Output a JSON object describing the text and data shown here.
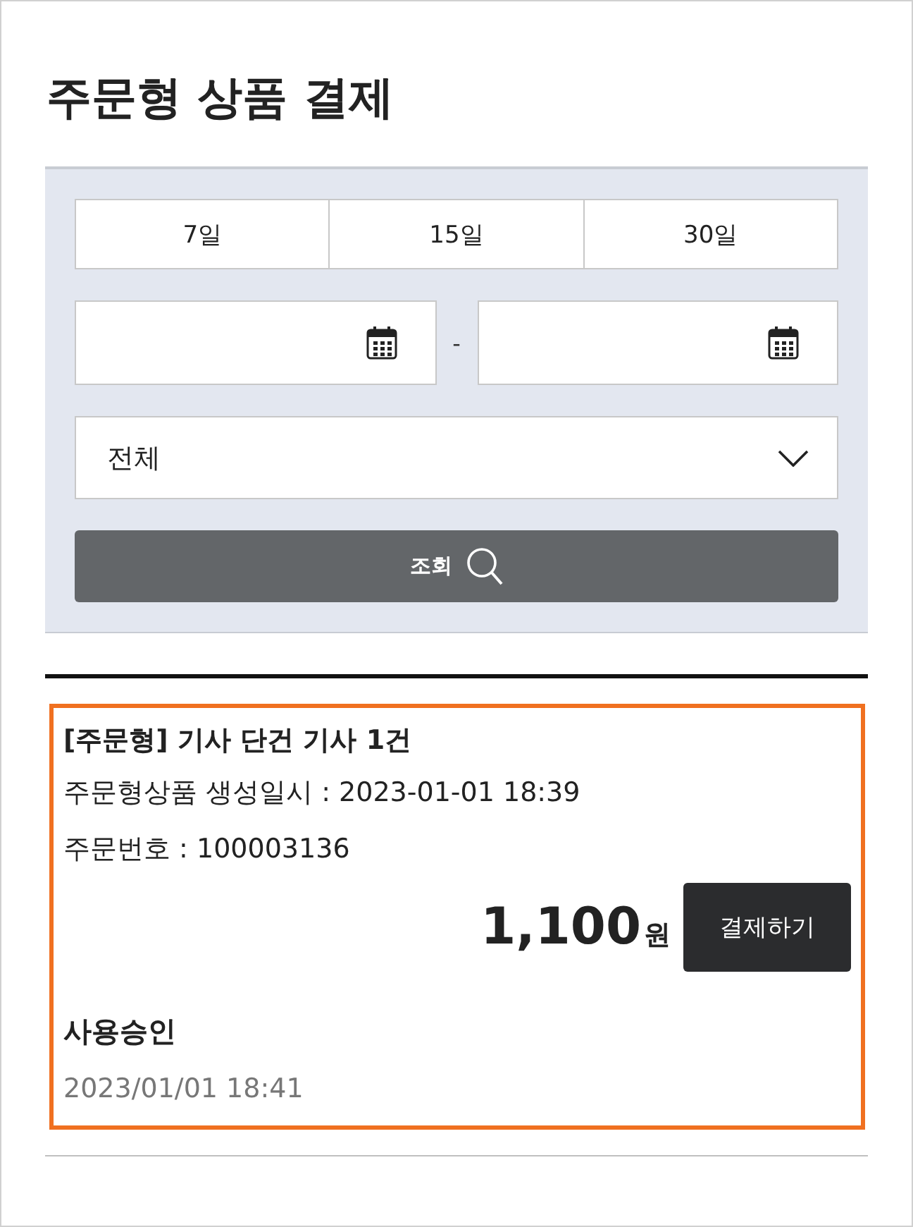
{
  "title": "주문형 상품 결제",
  "filter": {
    "periods": [
      {
        "label": "7일",
        "selected": false
      },
      {
        "label": "15일",
        "selected": false
      },
      {
        "label": "30일",
        "selected": false
      }
    ],
    "date_separator": "-",
    "status_select": {
      "value": "전체"
    },
    "search_button": "조회"
  },
  "orders": [
    {
      "highlighted": true,
      "name": "[주문형] 기사 단건 기사 1건",
      "created": "주문형상품 생성일시 : 2023-01-01 18:39",
      "order_no_label": "주문번호 : ",
      "order_no": "100003136",
      "amount": "1,100",
      "currency": "원",
      "pay_button": "결제하기",
      "status": "사용승인",
      "status_time": "2023/01/01 18:41"
    }
  ]
}
